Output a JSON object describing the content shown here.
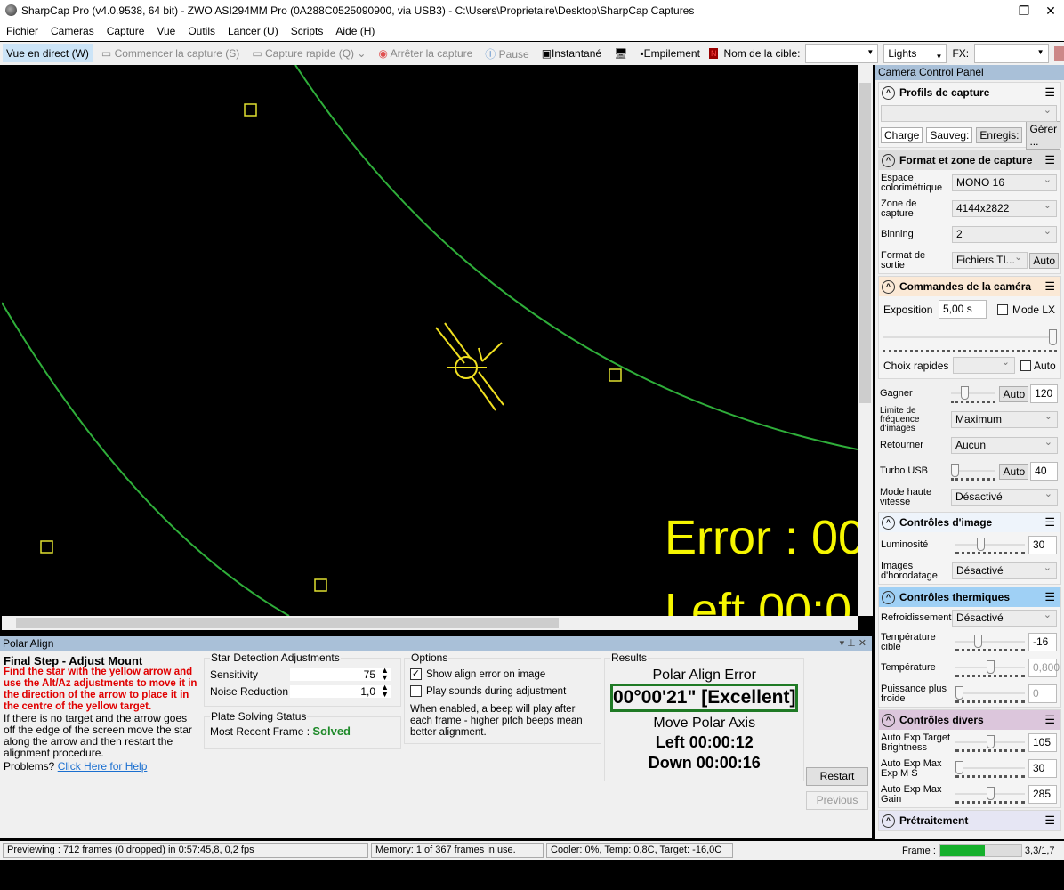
{
  "title": "SharpCap Pro (v4.0.9538, 64 bit) - ZWO ASI294MM Pro (0A288C0525090900, via USB3) - C:\\Users\\Proprietaire\\Desktop\\SharpCap Captures",
  "window": {
    "minimize": "—",
    "restore": "❐",
    "close": "✕"
  },
  "menu": [
    "Fichier",
    "Cameras",
    "Capture",
    "Vue",
    "Outils",
    "Lancer (U)",
    "Scripts",
    "Aide (H)"
  ],
  "toolbar": {
    "live": "Vue en direct (W)",
    "start": "Commencer la capture (S)",
    "quick": "Capture rapide (Q)",
    "stop": "Arrêter la capture",
    "pause": "Pause",
    "snapshot": "Instantané",
    "stack": "Empilement",
    "target_label": "Nom de la cible:",
    "target_value": "",
    "frame_type": "Lights",
    "fx_label": "FX:",
    "fx_value": ""
  },
  "overlay": {
    "error_text": "Error : 00",
    "left_text": "Left 00:0"
  },
  "panel": {
    "title": "Camera Control Panel",
    "profiles": {
      "title": "Profils de capture",
      "buttons": [
        "Charge",
        "Sauveg:",
        "Enregis:",
        "Gérer ..."
      ]
    },
    "format": {
      "title": "Format et zone de capture",
      "rows": [
        {
          "label": "Espace colorimétrique",
          "value": "MONO 16"
        },
        {
          "label": "Zone de capture",
          "value": "4144x2822"
        },
        {
          "label": "Binning",
          "value": "2"
        },
        {
          "label": "Format de sortie",
          "value": "Fichiers TI...",
          "button": "Auto"
        }
      ]
    },
    "camera": {
      "title": "Commandes de la caméra",
      "exposure_label": "Exposition",
      "exposure_value": "5,00 s",
      "lx_label": "Mode LX",
      "quick_label": "Choix rapides",
      "auto_label": "Auto",
      "gain_label": "Gagner",
      "gain_auto": "Auto",
      "gain_value": "120",
      "gain_level": 0.25,
      "fps_label": "Limite de fréquence d'images",
      "fps_value": "Maximum",
      "flip_label": "Retourner",
      "flip_value": "Aucun",
      "turbo_label": "Turbo USB",
      "turbo_auto": "Auto",
      "turbo_value": "40",
      "turbo_level": 0.0,
      "hs_label": "Mode haute vitesse",
      "hs_value": "Désactivé"
    },
    "image": {
      "title": "Contrôles d'image",
      "brightness_label": "Luminosité",
      "brightness_value": "30",
      "brightness_level": 0.35,
      "timestamp_label": "Images d'horodatage",
      "timestamp_value": "Désactivé"
    },
    "thermal": {
      "title": "Contrôles thermiques",
      "cooling_label": "Refroidissement",
      "cooling_value": "Désactivé",
      "target_label": "Température cible",
      "target_value": "-16",
      "target_level": 0.3,
      "temp_label": "Température",
      "temp_value": "0,800",
      "temp_level": 0.5,
      "power_label": "Puissance plus froide",
      "power_value": "0",
      "power_level": 0
    },
    "misc": {
      "title": "Contrôles divers",
      "rows": [
        {
          "label": "Auto Exp Target Brightness",
          "value": "105",
          "level": 0.5
        },
        {
          "label": "Auto Exp Max Exp M S",
          "value": "30",
          "level": 0
        },
        {
          "label": "Auto Exp Max Gain",
          "value": "285",
          "level": 0.5
        }
      ]
    },
    "preprocessing": {
      "title": "Prétraitement"
    }
  },
  "polar": {
    "title": "Polar Align",
    "step_title": "Final Step - Adjust Mount",
    "instruction": "Find the star with the yellow arrow and use the Alt/Az adjustments to move it in the direction of the arrow to place it in the centre of the yellow target.",
    "note": "If there is no target and the arrow goes off the edge of the screen move the star along the arrow and then restart the alignment procedure.",
    "problems": "Problems?",
    "help_link": "Click Here for Help",
    "detection": {
      "title": "Star Detection Adjustments",
      "sensitivity_label": "Sensitivity",
      "sensitivity_value": "75",
      "noise_label": "Noise Reduction",
      "noise_value": "1,0"
    },
    "plate": {
      "title": "Plate Solving Status",
      "label": "Most Recent Frame :",
      "value": "Solved"
    },
    "options": {
      "title": "Options",
      "show_error": "Show align error on image",
      "show_error_checked": true,
      "sounds": "Play sounds during adjustment",
      "sounds_checked": false,
      "note": "When enabled, a beep will play after each frame - higher pitch beeps mean better alignment."
    },
    "results": {
      "title": "Results",
      "error_title": "Polar Align Error",
      "error_value": "00°00'21\" [Excellent]",
      "move_title": "Move Polar Axis",
      "left": "Left 00:00:12",
      "down": "Down 00:00:16"
    },
    "restart": "Restart",
    "previous": "Previous"
  },
  "status": {
    "preview": "Previewing : 712 frames (0 dropped) in 0:57:45,8, 0,2 fps",
    "memory": "Memory: 1 of 367 frames in use.",
    "cooler": "Cooler: 0%, Temp: 0,8C, Target: -16,0C",
    "frame_label": "Frame :",
    "frame_progress": 0.55,
    "frame_value": "3,3/1,7"
  }
}
